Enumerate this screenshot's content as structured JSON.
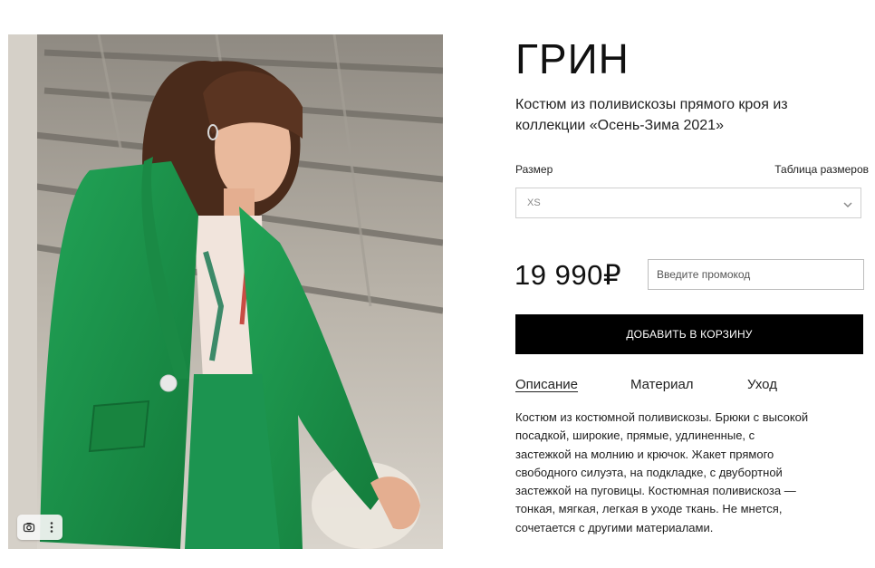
{
  "product": {
    "title": "ГРИН",
    "subtitle": "Костюм из поливискозы прямого кроя из коллекции «Осень-Зима 2021»",
    "size_label": "Размер",
    "size_table_link": "Таблица размеров",
    "size_selected": "XS",
    "price": "19 990₽",
    "promo_placeholder": "Введите промокод",
    "add_to_cart": "ДОБАВИТЬ В КОРЗИНУ",
    "tabs": [
      {
        "label": "Описание",
        "active": true
      },
      {
        "label": "Материал",
        "active": false
      },
      {
        "label": "Уход",
        "active": false
      }
    ],
    "description": "Костюм из костюмной поливискозы. Брюки с высокой посадкой, широкие, прямые, удлиненные, с застежкой на молнию и крючок. Жакет прямого свободного силуэта, на подкладке, с двубортной застежкой на пуговицы. Костюмная поливискоза — тонкая, мягкая, легкая в уходе ткань. Не мнется, сочетается с другими материалами."
  },
  "photo": {
    "tools": [
      "lens-icon",
      "more-vertical-icon"
    ]
  },
  "colors": {
    "accent": "#000000",
    "suit_green": "#1f9a4e",
    "border": "#cfcfcf"
  }
}
